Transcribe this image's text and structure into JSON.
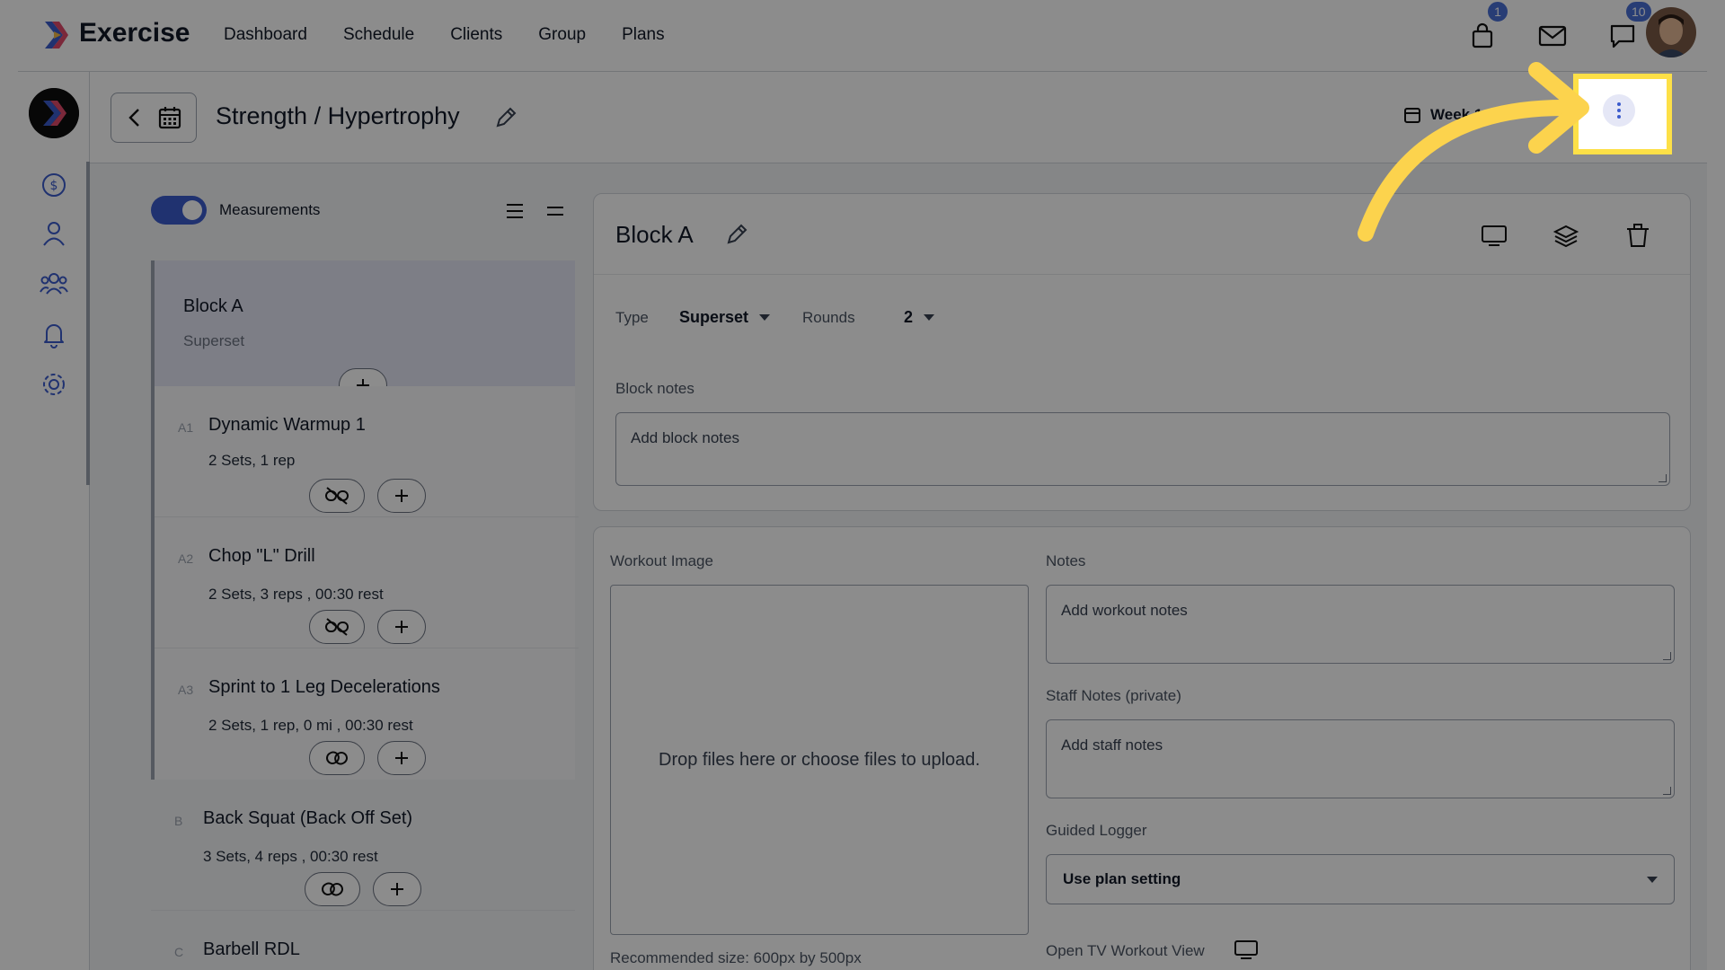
{
  "app": {
    "brand": "Exercise",
    "nav": [
      "Dashboard",
      "Schedule",
      "Clients",
      "Group",
      "Plans"
    ],
    "badges": {
      "shop": "1",
      "messages": "10"
    }
  },
  "header": {
    "title": "Strength / Hypertrophy",
    "week": "Week 1"
  },
  "measurements": {
    "label": "Measurements",
    "enabled": true
  },
  "block_list": {
    "block": {
      "name": "Block A",
      "type": "Superset"
    },
    "exercises": [
      {
        "code": "A1",
        "name": "Dynamic Warmup 1",
        "meta": "2 Sets, 1 rep"
      },
      {
        "code": "A2",
        "name": "Chop \"L\" Drill",
        "meta": "2 Sets, 3 reps , 00:30 rest"
      },
      {
        "code": "A3",
        "name": "Sprint to 1 Leg Decelerations",
        "meta": "2 Sets, 1 rep, 0 mi , 00:30 rest"
      },
      {
        "code": "B",
        "name": "Back Squat (Back Off Set)",
        "meta": "3 Sets, 4 reps , 00:30 rest"
      },
      {
        "code": "C",
        "name": "Barbell RDL",
        "meta": ""
      }
    ]
  },
  "block_panel": {
    "title": "Block A",
    "type_label": "Type",
    "type_value": "Superset",
    "rounds_label": "Rounds",
    "rounds_value": "2",
    "notes_label": "Block notes",
    "notes_placeholder": "Add block notes"
  },
  "workout_panel": {
    "image_label": "Workout Image",
    "dropzone_text": "Drop files here or choose files to upload.",
    "recommended": "Recommended size: 600px by 500px",
    "notes_label": "Notes",
    "notes_placeholder": "Add workout notes",
    "staff_label": "Staff Notes (private)",
    "staff_placeholder": "Add staff notes",
    "logger_label": "Guided Logger",
    "logger_value": "Use plan setting",
    "tv_label": "Open TV Workout View"
  },
  "colors": {
    "accent": "#3b5bcc",
    "highlight": "#fde047",
    "badge": "#4a6fd6"
  }
}
